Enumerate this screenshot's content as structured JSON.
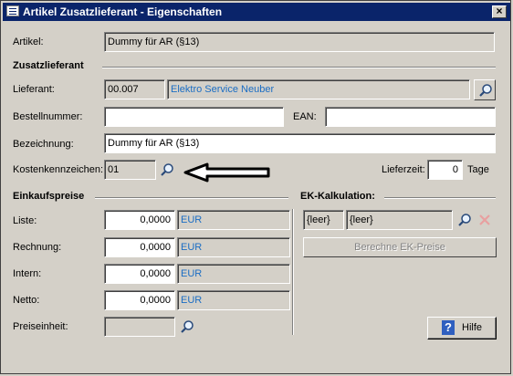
{
  "window": {
    "title": "Artikel Zusatzlieferant - Eigenschaften",
    "close_label": "×"
  },
  "artikel": {
    "label": "Artikel:",
    "value": "Dummy für AR (§13)"
  },
  "zusatzlieferant": {
    "title": "Zusatzlieferant",
    "lieferant_label": "Lieferant:",
    "lieferant_nr": "00.007",
    "lieferant_name": "Elektro Service Neuber",
    "bestellnummer_label": "Bestellnummer:",
    "bestellnummer_value": "",
    "ean_label": "EAN:",
    "ean_value": "",
    "bezeichnung_label": "Bezeichnung:",
    "bezeichnung_value": "Dummy für AR (§13)",
    "kostenkennzeichen_label": "Kostenkennzeichen:",
    "kostenkennzeichen_value": "01",
    "lieferzeit_label": "Lieferzeit:",
    "lieferzeit_value": "0",
    "lieferzeit_unit": "Tage"
  },
  "einkaufspreise": {
    "title": "Einkaufspreise",
    "rows": [
      {
        "label": "Liste:",
        "value": "0,0000",
        "currency": "EUR"
      },
      {
        "label": "Rechnung:",
        "value": "0,0000",
        "currency": "EUR"
      },
      {
        "label": "Intern:",
        "value": "0,0000",
        "currency": "EUR"
      },
      {
        "label": "Netto:",
        "value": "0,0000",
        "currency": "EUR"
      }
    ],
    "preiseinheit_label": "Preiseinheit:",
    "preiseinheit_value": ""
  },
  "ek_kalkulation": {
    "title": "EK-Kalkulation:",
    "field1": "{leer}",
    "field2": "{leer}",
    "berechne_label": "Berechne EK-Preise"
  },
  "hilfe": {
    "label": "Hilfe",
    "icon": "?"
  },
  "colors": {
    "titlebar": "#0a246a",
    "link": "#1a6dc4",
    "face": "#d4d0c8"
  }
}
